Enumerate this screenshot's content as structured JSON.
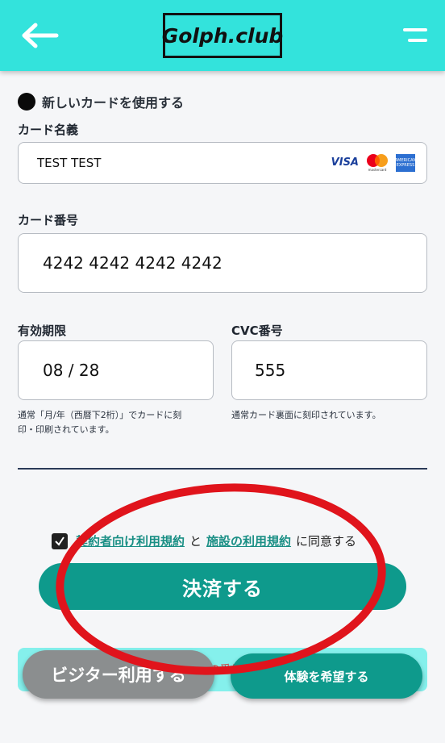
{
  "header": {
    "logo_text": "Golph.club",
    "accent_color": "#33e3dc"
  },
  "payment": {
    "new_card_label": "新しいカードを使用する",
    "card_name_label": "カード名義",
    "card_name_value": "TEST TEST",
    "brands": {
      "visa": "VISA",
      "mastercard_caption": "mastercard",
      "amex": "AMERICAN EXPRESS"
    },
    "card_number_label": "カード番号",
    "card_number_value": "4242 4242 4242 4242",
    "expiry_label": "有効期限",
    "expiry_value": "08 / 28",
    "expiry_hint_line1": "通常「月/年（西暦下2桁）」でカードに刻",
    "expiry_hint_line2": "印・印刷されています。",
    "cvc_label": "CVC番号",
    "cvc_value": "555",
    "cvc_hint": "通常カード裏面に刻印されています。"
  },
  "agreement": {
    "link1": "契約者向け利用規約",
    "connector": "と",
    "link2": "施設の利用規約",
    "suffix": "に同意する",
    "checked": true
  },
  "actions": {
    "pay_label": "決済する",
    "visitor_label": "ビジター利用する",
    "trial_label": "体験を希望する",
    "bottom_bar_text": "の受付"
  },
  "annotation": {
    "stroke_color": "#e0141c"
  }
}
